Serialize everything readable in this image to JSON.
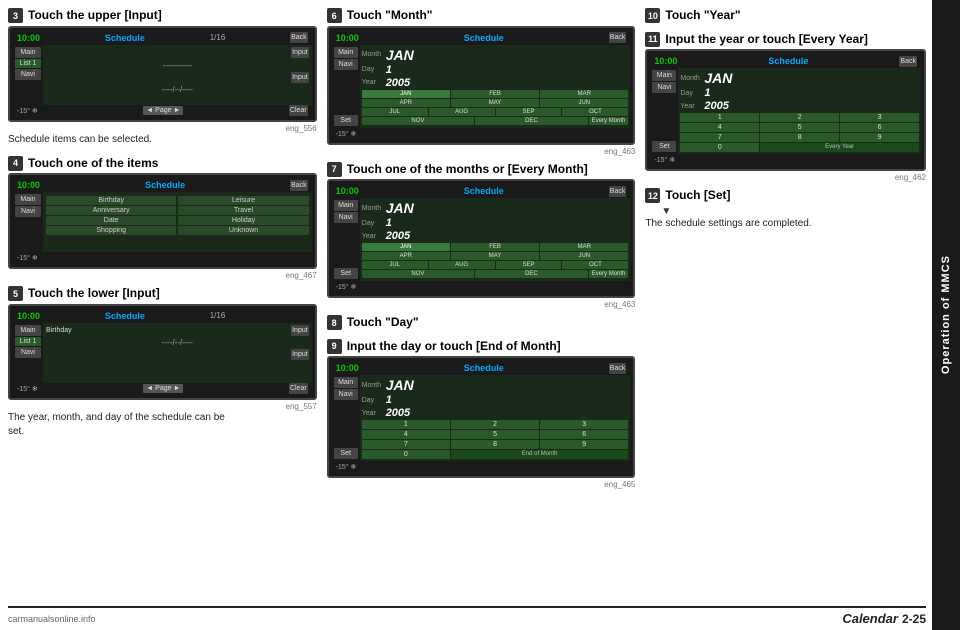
{
  "sidebar": {
    "label": "Operation of MMCS"
  },
  "steps": {
    "step3": {
      "badge": "3",
      "heading": "Touch the upper [Input]",
      "caption": "Schedule items can be selected.",
      "img_label": "eng_556",
      "screen": {
        "time": "10:00",
        "title": "Schedule",
        "page": "1/16",
        "list_label": "List 1",
        "btn_back": "Back",
        "btn_input1": "Input",
        "btn_input2": "Input",
        "btn_clear": "Clear",
        "dashes1": "-----------",
        "dashes2": "----/--/----",
        "nav": "◄ Page ►"
      }
    },
    "step4": {
      "badge": "4",
      "heading": "Touch one of the items",
      "img_label": "eng_467",
      "screen": {
        "time": "10:00",
        "title": "Schedule",
        "btn_back": "Back",
        "items": [
          "Birthday",
          "Leisure",
          "Anniversary",
          "Travel",
          "Date",
          "Holiday",
          "Shopping",
          "Unknown"
        ]
      }
    },
    "step5": {
      "badge": "5",
      "heading": "Touch the lower [Input]",
      "caption1": "The year, month, and day of the schedule can be",
      "caption2": "set.",
      "img_label": "eng_557",
      "screen": {
        "time": "10:00",
        "title": "Schedule",
        "page": "1/16",
        "list_label": "List 1",
        "item": "Birthday",
        "btn_input": "Input",
        "dashes": "----/--/----",
        "btn_input2": "Input",
        "btn_clear": "Clear",
        "nav": "◄ Page ►"
      }
    },
    "step6": {
      "badge": "6",
      "heading": "Touch \"Month\"",
      "img_label": "eng_463",
      "screen": {
        "time": "10:00",
        "title": "Schedule",
        "btn_back": "Back",
        "month_label": "Month",
        "month_value": "JAN",
        "day_label": "Day",
        "day_value": "1",
        "year_label": "Year",
        "year_value": "2005",
        "months": [
          "JAN",
          "FEB",
          "MAR",
          "APR",
          "MAY",
          "JUN",
          "JUL",
          "AUG",
          "SEP",
          "OCT",
          "NOV",
          "DEC",
          "Every Month"
        ]
      }
    },
    "step7": {
      "badge": "7",
      "heading": "Touch one of the months or [Every Month]",
      "img_label": "eng_463",
      "screen": {
        "time": "10:00",
        "title": "Schedule",
        "btn_back": "Back",
        "month_label": "Month",
        "month_value": "JAN",
        "day_label": "Day",
        "day_value": "1",
        "year_label": "Year",
        "year_value": "2005",
        "months": [
          "JAN",
          "FEB",
          "MAR",
          "APR",
          "MAY",
          "JUN",
          "JUL",
          "AUG",
          "SEP",
          "OCT",
          "NOV",
          "DEC",
          "Every Month"
        ]
      }
    },
    "step8": {
      "badge": "8",
      "heading": "Touch \"Day\""
    },
    "step9": {
      "badge": "9",
      "heading": "Input the day or touch [End of Month]",
      "img_label": "eng_465",
      "screen": {
        "time": "10:00",
        "title": "Schedule",
        "btn_back": "Back",
        "month_label": "Month",
        "month_value": "JAN",
        "day_label": "Day",
        "day_value": "1",
        "year_label": "Year",
        "year_value": "2005",
        "numbers": [
          "1",
          "2",
          "3",
          "4",
          "5",
          "6",
          "7",
          "8",
          "9",
          "0",
          "End of Month"
        ]
      }
    },
    "step10": {
      "badge": "10",
      "heading": "Touch \"Year\""
    },
    "step11": {
      "badge": "11",
      "heading": "Input the year or touch [Every Year]",
      "img_label": "eng_462",
      "screen": {
        "time": "10:00",
        "title": "Schedule",
        "btn_back": "Back",
        "month_label": "Month",
        "month_value": "JAN",
        "day_label": "Day",
        "day_value": "1",
        "year_label": "Year",
        "year_value": "2005",
        "numbers": [
          "1",
          "2",
          "3",
          "4",
          "5",
          "6",
          "7",
          "8",
          "9",
          "0",
          "Every Year"
        ]
      }
    },
    "step12": {
      "badge": "12",
      "heading": "Touch [Set]",
      "arrow": "▼",
      "caption": "The schedule settings are completed."
    }
  },
  "footer": {
    "left_line": "——————————————————————————————————————————————————————————————————————————",
    "chapter": "Calendar",
    "page": "2-25",
    "watermark": "carmanualsonline.info"
  }
}
